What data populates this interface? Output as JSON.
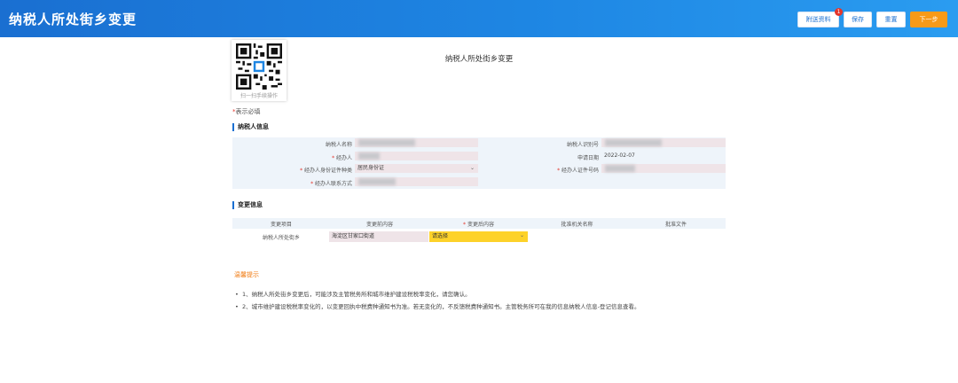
{
  "header": {
    "title": "纳税人所处街乡变更",
    "buttons": {
      "attachments": "附送资料",
      "attachments_badge": "1",
      "save": "保存",
      "reset": "重置",
      "next": "下一步"
    }
  },
  "qr": {
    "caption": "扫一扫手续操作"
  },
  "page_title": "纳税人所处街乡变更",
  "required_note": {
    "star": "*",
    "text": "表示必填"
  },
  "taxpayer_section": {
    "title": "纳税人信息",
    "fields": {
      "name_label": "纳税人名称",
      "taxid_label": "纳税人识别号",
      "agent_label": "经办人",
      "apply_date_label": "申请日期",
      "apply_date_value": "2022-02-07",
      "id_type_label": "经办人身份证件种类",
      "id_type_value": "居民身份证",
      "id_number_label": "经办人证件号码",
      "contact_label": "经办人联系方式"
    }
  },
  "change_section": {
    "title": "变更信息",
    "columns": [
      "变更项目",
      "变更前内容",
      "变更后内容",
      "批准机关名称",
      "批准文件"
    ],
    "row": {
      "item": "纳税人所处街乡",
      "before": "海淀区甘家口街道",
      "after": "请选择"
    }
  },
  "tips": {
    "title": "温馨提示",
    "items": [
      "1、纳税人所处街乡变更后，可能涉及主管税务所和城市维护建设税税率变化，请您确认。",
      "2、城市维护建设税税率变化的，以变更回执中税费种通知书为准。若无变化的，不反馈税费种通知书。主管税务所可在我的信息纳税人信息-登记信息查看。"
    ]
  },
  "colors": {
    "header_blue": "#1a6fd1",
    "primary_orange": "#f79a18",
    "select_highlight": "#fdd22a",
    "required_red": "#e3352b"
  }
}
